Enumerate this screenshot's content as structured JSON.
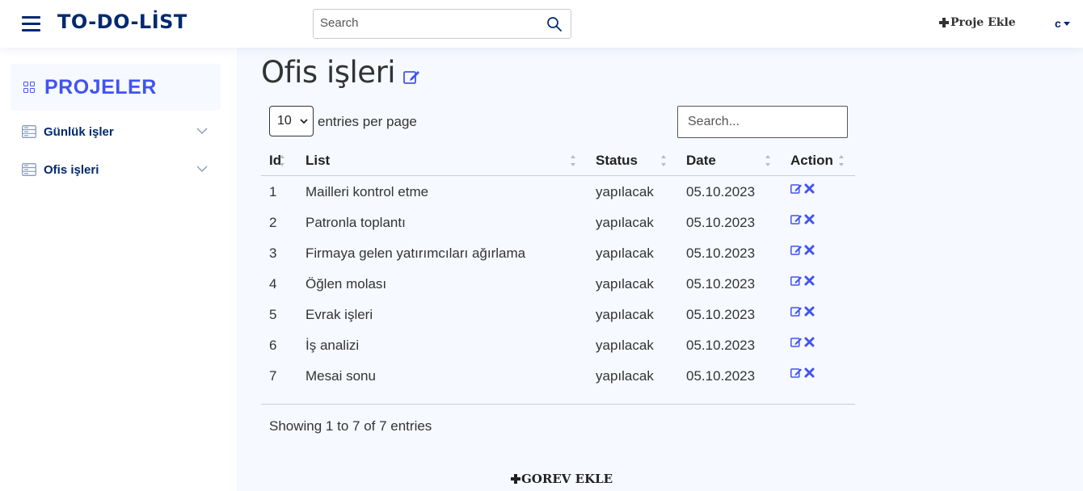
{
  "header": {
    "logo": "TO-DO-LİST",
    "search_placeholder": "Search",
    "add_project_label": "Proje Ekle",
    "user_initial": "c"
  },
  "sidebar": {
    "title": "PROJELER",
    "items": [
      {
        "label": "Günlük işler"
      },
      {
        "label": "Ofis işleri"
      }
    ]
  },
  "main": {
    "title": "Ofis işleri",
    "entries_per_page_value": "10",
    "entries_per_page_label": "entries per page",
    "table_search_placeholder": "Search...",
    "columns": [
      "Id",
      "List",
      "Status",
      "Date",
      "Action"
    ],
    "rows": [
      {
        "id": "1",
        "list": "Mailleri kontrol etme",
        "status": "yapılacak",
        "date": "05.10.2023"
      },
      {
        "id": "2",
        "list": "Patronla toplantı",
        "status": "yapılacak",
        "date": "05.10.2023"
      },
      {
        "id": "3",
        "list": "Firmaya gelen yatırımcıları ağırlama",
        "status": "yapılacak",
        "date": "05.10.2023"
      },
      {
        "id": "4",
        "list": "Öğlen molası",
        "status": "yapılacak",
        "date": "05.10.2023"
      },
      {
        "id": "5",
        "list": "Evrak işleri",
        "status": "yapılacak",
        "date": "05.10.2023"
      },
      {
        "id": "6",
        "list": "İş analizi",
        "status": "yapılacak",
        "date": "05.10.2023"
      },
      {
        "id": "7",
        "list": "Mesai sonu",
        "status": "yapılacak",
        "date": "05.10.2023"
      }
    ],
    "showing_text": "Showing 1 to 7 of 7 entries",
    "add_task_label": "GOREV EKLE"
  },
  "colors": {
    "brand": "#012970",
    "accent": "#4154f1",
    "background": "#f6f9ff"
  }
}
